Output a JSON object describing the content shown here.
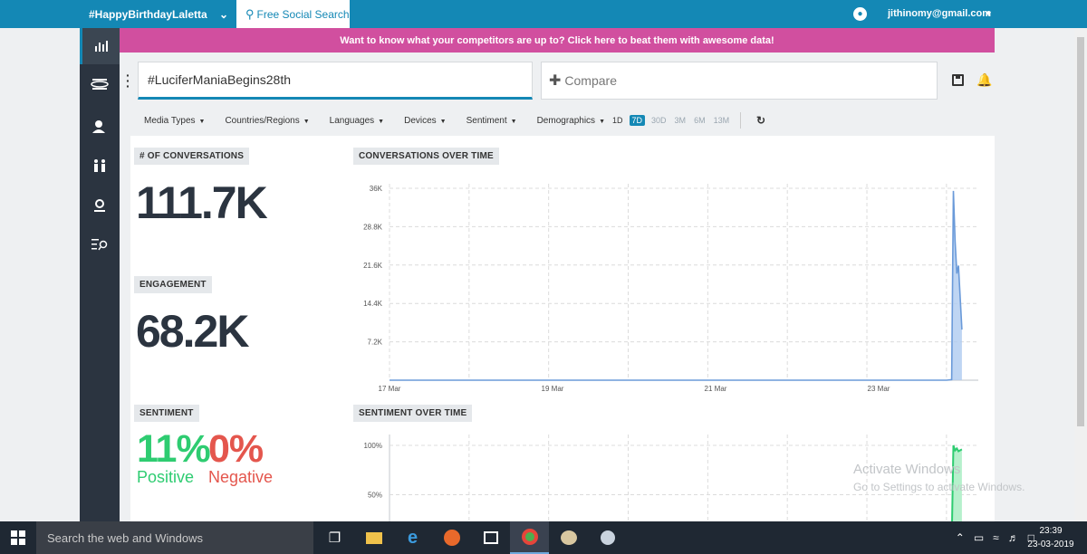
{
  "topbar": {
    "trend_label": "#HappyBirthdayLaletta",
    "free_search_label": "Free Social Search",
    "user_email": "jithinomy@gmail.com"
  },
  "promo_text": "Want to know what your competitors are up to? Click here to beat them with awesome data!",
  "search": {
    "query": "#LuciferManiaBegins28th",
    "compare_label": "Compare"
  },
  "filters": [
    "Media Types",
    "Countries/Regions",
    "Languages",
    "Devices",
    "Sentiment",
    "Demographics"
  ],
  "ranges": [
    "1D",
    "7D",
    "30D",
    "3M",
    "6M",
    "13M"
  ],
  "selected_range": "7D",
  "metrics": {
    "conversations_title": "# OF CONVERSATIONS",
    "conversations_value": "111.7K",
    "engagement_title": "ENGAGEMENT",
    "engagement_value": "68.2K",
    "sentiment_title": "SENTIMENT",
    "positive_value": "11%",
    "positive_label": "Positive",
    "negative_value": "0%",
    "negative_label": "Negative"
  },
  "charts": {
    "conversations_title": "CONVERSATIONS OVER TIME",
    "sentiment_title": "SENTIMENT OVER TIME"
  },
  "chart_data": [
    {
      "type": "area",
      "title": "CONVERSATIONS OVER TIME",
      "y_ticks": [
        "36K",
        "28.8K",
        "21.6K",
        "14.4K",
        "7.2K"
      ],
      "ylim": [
        0,
        36000
      ],
      "x_ticks": [
        "17 Mar",
        "19 Mar",
        "21 Mar",
        "23 Mar"
      ],
      "grid": true,
      "color": "#6a9ad9",
      "series": [
        {
          "x": [
            "2019-03-16",
            "2019-03-17",
            "2019-03-18",
            "2019-03-19",
            "2019-03-20",
            "2019-03-21",
            "2019-03-22",
            "2019-03-23",
            "2019-03-23T18:00",
            "2019-03-23T20:00",
            "2019-03-23T21:30",
            "2019-03-23T22:00",
            "2019-03-23T22:30",
            "2019-03-23T23:00",
            "2019-03-23T23:30",
            "2019-03-24T00:30"
          ],
          "values": [
            0,
            0,
            0,
            0,
            0,
            0,
            0,
            0,
            0,
            0,
            100,
            35500,
            26000,
            20000,
            21500,
            9500
          ]
        }
      ]
    },
    {
      "type": "area",
      "title": "SENTIMENT OVER TIME",
      "y_ticks": [
        "100%",
        "50%"
      ],
      "ylim": [
        0,
        100
      ],
      "grid": true,
      "color": "#2ecc71",
      "series": [
        {
          "x": [
            "2019-03-23T21:30",
            "2019-03-23T22:00",
            "2019-03-23T22:30",
            "2019-03-23T23:00",
            "2019-03-23T23:30",
            "2019-03-24T00:30"
          ],
          "values": [
            0,
            100,
            95,
            97,
            94,
            96
          ]
        }
      ]
    }
  ],
  "watermark": {
    "line1": "Activate Windows",
    "line2": "Go to Settings to activate Windows."
  },
  "taskbar": {
    "search_placeholder": "Search the web and Windows",
    "time": "23:39",
    "date": "23-03-2019"
  }
}
